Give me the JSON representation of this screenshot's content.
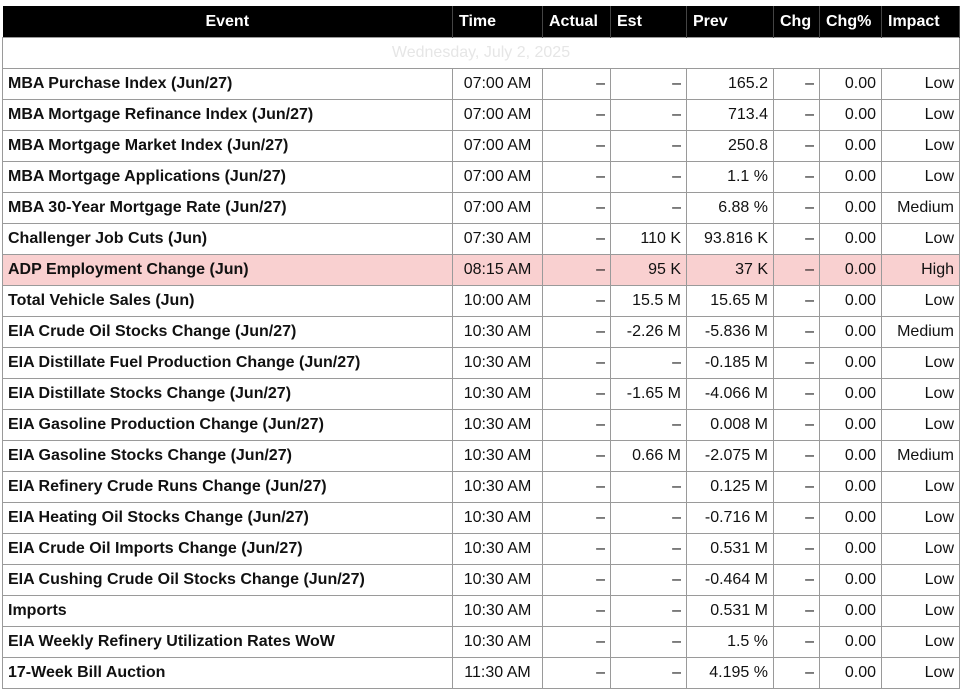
{
  "headers": {
    "event": "Event",
    "time": "Time",
    "actual": "Actual",
    "est": "Est",
    "prev": "Prev",
    "chg": "Chg",
    "chg_pct": "Chg%",
    "impact": "Impact"
  },
  "date_label": "Wednesday, July 2, 2025",
  "rows": [
    {
      "event": "MBA Purchase Index (Jun/27)",
      "time": "07:00 AM",
      "actual": "–",
      "est": "–",
      "prev": "165.2",
      "chg": "–",
      "chg_pct": "0.00",
      "impact": "Low"
    },
    {
      "event": "MBA Mortgage Refinance Index (Jun/27)",
      "time": "07:00 AM",
      "actual": "–",
      "est": "–",
      "prev": "713.4",
      "chg": "–",
      "chg_pct": "0.00",
      "impact": "Low"
    },
    {
      "event": "MBA Mortgage Market Index (Jun/27)",
      "time": "07:00 AM",
      "actual": "–",
      "est": "–",
      "prev": "250.8",
      "chg": "–",
      "chg_pct": "0.00",
      "impact": "Low"
    },
    {
      "event": "MBA Mortgage Applications (Jun/27)",
      "time": "07:00 AM",
      "actual": "–",
      "est": "–",
      "prev": "1.1 %",
      "chg": "–",
      "chg_pct": "0.00",
      "impact": "Low"
    },
    {
      "event": "MBA 30-Year Mortgage Rate (Jun/27)",
      "time": "07:00 AM",
      "actual": "–",
      "est": "–",
      "prev": "6.88 %",
      "chg": "–",
      "chg_pct": "0.00",
      "impact": "Medium"
    },
    {
      "event": "Challenger Job Cuts (Jun)",
      "time": "07:30 AM",
      "actual": "–",
      "est": "110 K",
      "prev": "93.816 K",
      "chg": "–",
      "chg_pct": "0.00",
      "impact": "Low"
    },
    {
      "event": "ADP Employment Change (Jun)",
      "time": "08:15 AM",
      "actual": "–",
      "est": "95 K",
      "prev": "37 K",
      "chg": "–",
      "chg_pct": "0.00",
      "impact": "High",
      "highlight": true
    },
    {
      "event": "Total Vehicle Sales (Jun)",
      "time": "10:00 AM",
      "actual": "–",
      "est": "15.5 M",
      "prev": "15.65 M",
      "chg": "–",
      "chg_pct": "0.00",
      "impact": "Low"
    },
    {
      "event": "EIA Crude Oil Stocks Change (Jun/27)",
      "time": "10:30 AM",
      "actual": "–",
      "est": "-2.26 M",
      "prev": "-5.836 M",
      "chg": "–",
      "chg_pct": "0.00",
      "impact": "Medium"
    },
    {
      "event": "EIA Distillate Fuel Production Change (Jun/27)",
      "time": "10:30 AM",
      "actual": "–",
      "est": "–",
      "prev": "-0.185 M",
      "chg": "–",
      "chg_pct": "0.00",
      "impact": "Low"
    },
    {
      "event": "EIA Distillate Stocks Change (Jun/27)",
      "time": "10:30 AM",
      "actual": "–",
      "est": "-1.65 M",
      "prev": "-4.066 M",
      "chg": "–",
      "chg_pct": "0.00",
      "impact": "Low"
    },
    {
      "event": "EIA Gasoline Production Change (Jun/27)",
      "time": "10:30 AM",
      "actual": "–",
      "est": "–",
      "prev": "0.008 M",
      "chg": "–",
      "chg_pct": "0.00",
      "impact": "Low"
    },
    {
      "event": "EIA Gasoline Stocks Change (Jun/27)",
      "time": "10:30 AM",
      "actual": "–",
      "est": "0.66 M",
      "prev": "-2.075 M",
      "chg": "–",
      "chg_pct": "0.00",
      "impact": "Medium"
    },
    {
      "event": "EIA Refinery Crude Runs Change (Jun/27)",
      "time": "10:30 AM",
      "actual": "–",
      "est": "–",
      "prev": "0.125 M",
      "chg": "–",
      "chg_pct": "0.00",
      "impact": "Low"
    },
    {
      "event": "EIA Heating Oil Stocks Change (Jun/27)",
      "time": "10:30 AM",
      "actual": "–",
      "est": "–",
      "prev": "-0.716 M",
      "chg": "–",
      "chg_pct": "0.00",
      "impact": "Low"
    },
    {
      "event": "EIA Crude Oil Imports Change (Jun/27)",
      "time": "10:30 AM",
      "actual": "–",
      "est": "–",
      "prev": "0.531 M",
      "chg": "–",
      "chg_pct": "0.00",
      "impact": "Low"
    },
    {
      "event": "EIA Cushing Crude Oil Stocks Change (Jun/27)",
      "time": "10:30 AM",
      "actual": "–",
      "est": "–",
      "prev": "-0.464 M",
      "chg": "–",
      "chg_pct": "0.00",
      "impact": "Low"
    },
    {
      "event": "Imports",
      "time": "10:30 AM",
      "actual": "–",
      "est": "–",
      "prev": "0.531 M",
      "chg": "–",
      "chg_pct": "0.00",
      "impact": "Low"
    },
    {
      "event": "EIA Weekly Refinery Utilization Rates WoW",
      "time": "10:30 AM",
      "actual": "–",
      "est": "–",
      "prev": "1.5 %",
      "chg": "–",
      "chg_pct": "0.00",
      "impact": "Low"
    },
    {
      "event": "17-Week Bill Auction",
      "time": "11:30 AM",
      "actual": "–",
      "est": "–",
      "prev": "4.195 %",
      "chg": "–",
      "chg_pct": "0.00",
      "impact": "Low"
    }
  ],
  "colors": {
    "header_bg": "#000000",
    "header_text": "#ffffff",
    "high_impact_row_bg": "#f9d0d0",
    "grid_line": "#9a9a9a"
  }
}
